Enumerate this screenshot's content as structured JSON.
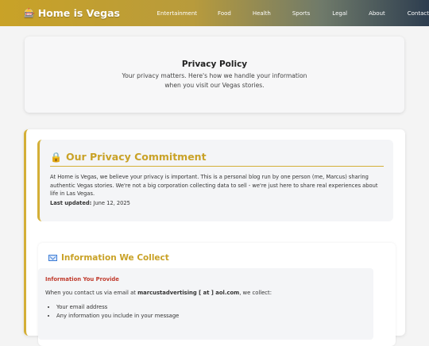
{
  "header": {
    "logo_icon": "🎰",
    "site_name": "Home is Vegas",
    "nav": [
      "Entertainment",
      "Food",
      "Health",
      "Sports",
      "Legal",
      "About",
      "Contact"
    ]
  },
  "hero": {
    "title": "Privacy Policy",
    "subtitle_line1": "Your privacy matters. Here's how we handle your information",
    "subtitle_line2": "when you visit our Vegas stories."
  },
  "commitment": {
    "icon": "🔒",
    "heading": "Our Privacy Commitment",
    "body": "At Home is Vegas, we believe your privacy is important. This is a personal blog run by one person (me, Marcus) sharing authentic Vegas stories. We're not a big corporation collecting data to sell - we're just here to share real experiences about life in Las Vegas.",
    "updated_label": "Last updated:",
    "updated_value": "June 12, 2025"
  },
  "collect": {
    "heading": "Information We Collect",
    "provide_heading": "Information You Provide",
    "provide_intro": "When you contact us via email at",
    "email": "marcustadvertising [ at ] aol.com",
    "provide_suffix": ", we collect:",
    "items": [
      "Your email address",
      "Any information you include in your message"
    ]
  },
  "colors": {
    "accent_gold": "#d4af37",
    "heading_gold": "#c9a227",
    "subheading_red": "#c0392b"
  }
}
